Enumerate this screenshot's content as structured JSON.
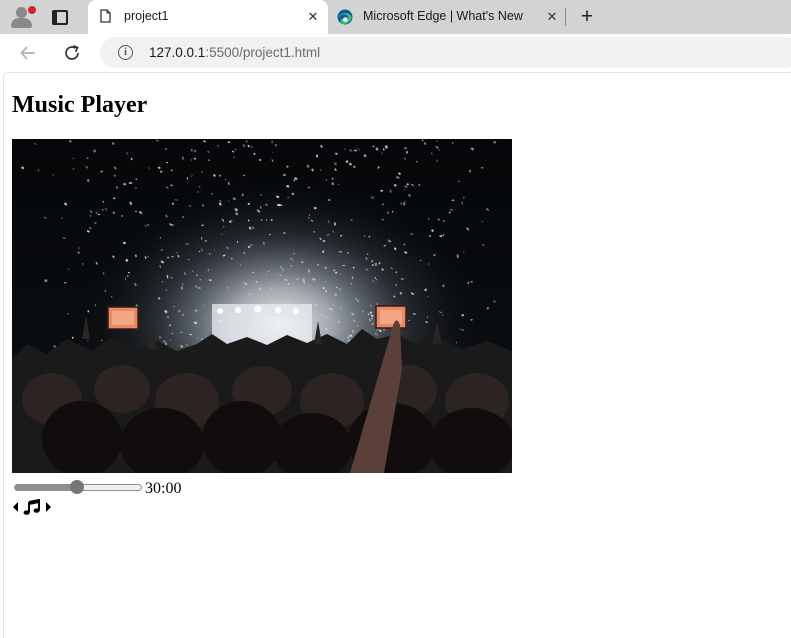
{
  "browser": {
    "tabs": [
      {
        "title": "project1",
        "active": true
      },
      {
        "title": "Microsoft Edge | What's New",
        "active": false
      }
    ],
    "address": {
      "host": "127.0.0.1",
      "rest": ":5500/project1.html"
    }
  },
  "icons": {
    "profile": "profile-avatar-icon",
    "workspaces": "workspaces-icon",
    "page": "page-document-icon",
    "edge": "edge-logo-icon",
    "close": "close-icon",
    "new_tab": "plus-icon",
    "back": "back-arrow-icon",
    "reload": "reload-icon",
    "info": "info-icon",
    "previous": "caret-left-icon",
    "music": "music-note-icon",
    "next": "caret-right-icon"
  },
  "colors": {
    "tab_strip": "#d3d3d3",
    "profile_badge": "#d6222a",
    "edge_blue": "#0c59a4",
    "edge_green": "#37c26b"
  },
  "page": {
    "title": "Music Player",
    "cover_image": "concert crowd with confetti and stage lights",
    "player": {
      "seek_fraction": 0.5,
      "time": "30:00"
    }
  }
}
